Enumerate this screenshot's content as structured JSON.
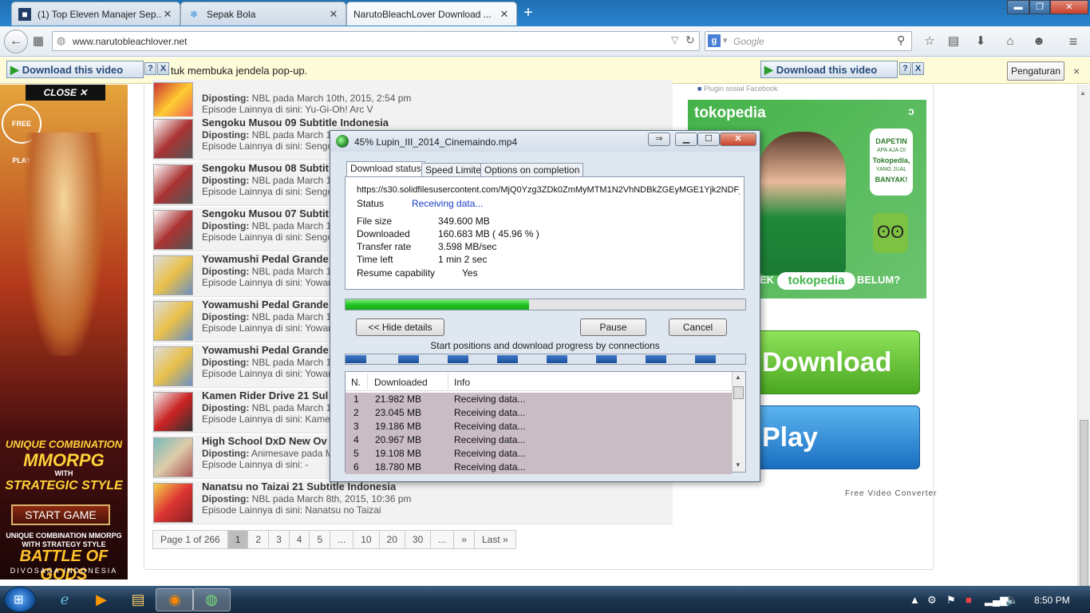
{
  "browser": {
    "tabs": [
      {
        "label": "(1) Top Eleven Manajer Sep...",
        "active": false,
        "icon": "top-eleven-icon"
      },
      {
        "label": "Sepak Bola",
        "active": false,
        "icon": "snowflake-icon"
      },
      {
        "label": "NarutoBleachLover Download ...",
        "active": true,
        "icon": "page-icon"
      }
    ],
    "url": "www.narutobleachlover.net",
    "search_placeholder": "Google"
  },
  "notification": {
    "download_video_label": "Download this video",
    "help": "?",
    "close": "X",
    "message": "tuk membuka jendela pop-up.",
    "settings_label": "Pengaturan",
    "dismiss": "×"
  },
  "left_ad": {
    "close_label": "CLOSE",
    "free_play": "FREE PLAY",
    "headline_1": "UNIQUE COMBINATION",
    "headline_2": "MMORPG",
    "headline_3": "WITH",
    "headline_4": "STRATEGIC STYLE",
    "start_game": "START GAME",
    "tagline": "UNIQUE COMBINATION MMORPG WITH STRATEGY STYLE",
    "brand": "BATTLE OF GODS",
    "brand_sub": "DIVOSAGA INDONESIA"
  },
  "posts": [
    {
      "title": "",
      "posted_label": "Diposting:",
      "author": "NBL pada",
      "date": "March 10th, 2015, 2:54 pm",
      "episodes": "Episode Lainnya di sini: Yu-Gi-Oh! Arc V"
    },
    {
      "title": "Sengoku Musou 09 Subtitle Indonesia",
      "posted_label": "Diposting:",
      "author": "NBL pada",
      "date": "March 10",
      "episodes": "Episode Lainnya di sini: Sengoku"
    },
    {
      "title": "Sengoku Musou 08 Subtit",
      "posted_label": "Diposting:",
      "author": "NBL pada",
      "date": "March 10",
      "episodes": "Episode Lainnya di sini: Sengoku"
    },
    {
      "title": "Sengoku Musou 07 Subtit",
      "posted_label": "Diposting:",
      "author": "NBL pada",
      "date": "March 10",
      "episodes": "Episode Lainnya di sini: Sengoku"
    },
    {
      "title": "Yowamushi Pedal Grande",
      "posted_label": "Diposting:",
      "author": "NBL pada",
      "date": "March 10",
      "episodes": "Episode Lainnya di sini: Yowam"
    },
    {
      "title": "Yowamushi Pedal Grande",
      "posted_label": "Diposting:",
      "author": "NBL pada",
      "date": "March 10",
      "episodes": "Episode Lainnya di sini: Yowam"
    },
    {
      "title": "Yowamushi Pedal Grande",
      "posted_label": "Diposting:",
      "author": "NBL pada",
      "date": "March 10",
      "episodes": "Episode Lainnya di sini: Yowam"
    },
    {
      "title": "Kamen Rider Drive 21 Sul",
      "posted_label": "Diposting:",
      "author": "NBL pada",
      "date": "March 10",
      "episodes": "Episode Lainnya di sini: Kamen"
    },
    {
      "title": "High School DxD New Ov",
      "posted_label": "Diposting:",
      "author": "Animesave pada",
      "date": "Ma",
      "episodes": "Episode Lainnya di sini: -"
    },
    {
      "title": "Nanatsu no Taizai 21 Subtitle Indonesia",
      "posted_label": "Diposting:",
      "author": "NBL pada",
      "date": "March 8th, 2015, 10:36 pm",
      "episodes": "Episode Lainnya di sini: Nanatsu no Taizai"
    }
  ],
  "pager": {
    "info": "Page 1 of 266",
    "pages": [
      "1",
      "2",
      "3",
      "4",
      "5",
      "...",
      "10",
      "20",
      "30",
      "...",
      "»",
      "Last »"
    ],
    "current": "1"
  },
  "right": {
    "fb_plugin": "Plugin sosial Facebook",
    "toko_brand": "tokopedia",
    "toko_bubble_1": "DAPETIN",
    "toko_bubble_2": "APA AJA DI",
    "toko_bubble_3": "Tokopedia,",
    "toko_bubble_4": "YANG JUAL",
    "toko_bubble_5": "BANYAK!",
    "toko_bottom_left": "EK",
    "toko_bottom_brand": "tokopedia",
    "toko_bottom_right": "BELUM?",
    "download_label": "Download",
    "play_label": "Play",
    "converter_label": "Free Video Converter"
  },
  "idm": {
    "title": "45% Lupin_III_2014_Cinemaindo.mp4",
    "tabs": [
      "Download status",
      "Speed Limiter",
      "Options on completion"
    ],
    "url": "https://s30.solidfilesusercontent.com/MjQ0Yzg3ZDk0ZmMyMTM1N2VhNDBkZGEyMGE1Yjk2NDFj.",
    "status_label": "Status",
    "status_value": "Receiving data...",
    "file_size_label": "File size",
    "file_size_value": "349.600  MB",
    "downloaded_label": "Downloaded",
    "downloaded_value": "160.683  MB  ( 45.96 % )",
    "transfer_label": "Transfer rate",
    "transfer_value": "3.598  MB/sec",
    "time_left_label": "Time left",
    "time_left_value": "1 min 2 sec",
    "resume_label": "Resume capability",
    "resume_value": "Yes",
    "progress": 0.4596,
    "hide_details": "<< Hide details",
    "pause": "Pause",
    "cancel": "Cancel",
    "connections_label": "Start positions and download progress by connections",
    "columns": [
      "N.",
      "Downloaded",
      "Info"
    ],
    "connections": [
      {
        "n": "1",
        "downloaded": "21.982  MB",
        "info": "Receiving data..."
      },
      {
        "n": "2",
        "downloaded": "23.045  MB",
        "info": "Receiving data..."
      },
      {
        "n": "3",
        "downloaded": "19.186  MB",
        "info": "Receiving data..."
      },
      {
        "n": "4",
        "downloaded": "20.967  MB",
        "info": "Receiving data..."
      },
      {
        "n": "5",
        "downloaded": "19.108  MB",
        "info": "Receiving data..."
      },
      {
        "n": "6",
        "downloaded": "18.780  MB",
        "info": "Receiving data..."
      }
    ]
  },
  "taskbar": {
    "clock": "8:50 PM"
  }
}
